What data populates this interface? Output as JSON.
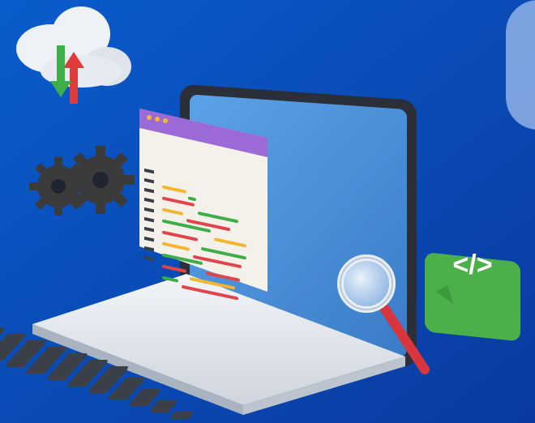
{
  "scene": {
    "background": {
      "from": "#0a5ccc",
      "to": "#0a3aa0"
    },
    "code_tag_text": "</>",
    "colors": {
      "screen": "#4f93dc",
      "screen_frame": "#2a2f3a",
      "laptop_base": "#e9edf2",
      "keys": "#3a3f48",
      "window_header": "#9b6ad6",
      "window_body": "#f4f1ea",
      "code_red": "#e0454b",
      "code_green": "#3fae48",
      "code_yellow": "#f2b631",
      "bubble": "#4cb04a",
      "magnifier_handle": "#d8363c",
      "cloud": "#eef1f6",
      "arrow_up": "#e23b3b",
      "arrow_down": "#3fae48",
      "gear": "#3b3b3b"
    },
    "icons": [
      "cloud-sync-icon",
      "gears-icon",
      "code-window-icon",
      "laptop-icon",
      "magnifier-icon",
      "code-bubble-icon"
    ]
  }
}
